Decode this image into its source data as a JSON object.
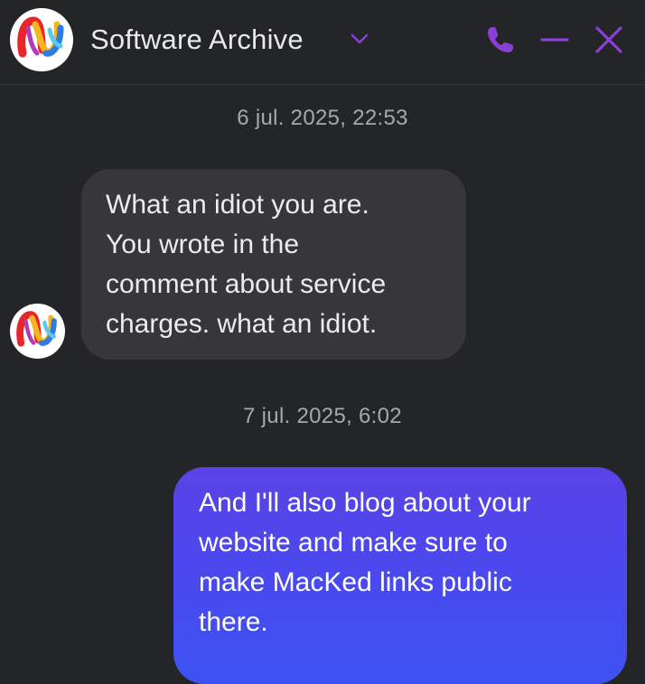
{
  "header": {
    "title": "Software Archive",
    "icons": [
      "app-logo",
      "chevron-down-icon",
      "phone-icon",
      "minimize-icon",
      "close-icon"
    ],
    "accent_color": "#8a3fd6"
  },
  "conversation": {
    "timestamps": [
      "6 jul. 2025, 22:53",
      "7 jul. 2025, 6:02"
    ],
    "messages": [
      {
        "direction": "incoming",
        "lines": [
          "What an idiot you are.",
          "You wrote in the",
          "comment about service",
          "charges. what an idiot."
        ]
      },
      {
        "direction": "outgoing",
        "lines": [
          "And I'll also blog about your",
          "website and make sure to",
          "make MacKed links public",
          "there."
        ]
      }
    ]
  }
}
